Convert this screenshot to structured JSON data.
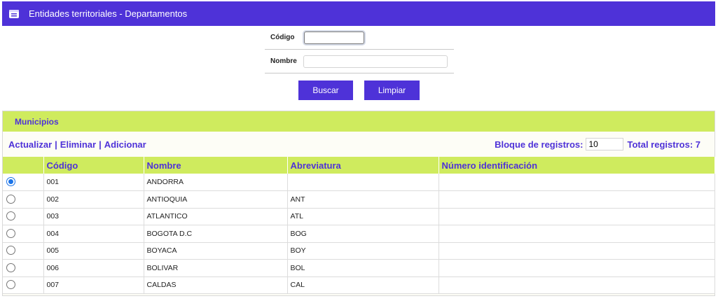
{
  "window": {
    "title": "Entidades territoriales - Departamentos",
    "accent": "#4e32d8",
    "panel_color": "#cfeb5e"
  },
  "search": {
    "codigo_label": "Código",
    "codigo_value": "",
    "nombre_label": "Nombre",
    "nombre_value": "",
    "buscar_label": "Buscar",
    "limpiar_label": "Limpiar"
  },
  "panel": {
    "title": "Municipios",
    "actions": {
      "actualizar": "Actualizar",
      "eliminar": "Eliminar",
      "adicionar": "Adicionar",
      "separator": "|"
    },
    "bloque_label": "Bloque de registros:",
    "bloque_value": "10",
    "total_label": "Total registros: 7"
  },
  "table": {
    "headers": [
      "",
      "Código",
      "Nombre",
      "Abreviatura",
      "Número identificación"
    ],
    "rows": [
      {
        "selected": true,
        "codigo": "001",
        "nombre": "ANDORRA",
        "abreviatura": "",
        "numero": ""
      },
      {
        "selected": false,
        "codigo": "002",
        "nombre": "ANTIOQUIA",
        "abreviatura": "ANT",
        "numero": ""
      },
      {
        "selected": false,
        "codigo": "003",
        "nombre": "ATLANTICO",
        "abreviatura": "ATL",
        "numero": ""
      },
      {
        "selected": false,
        "codigo": "004",
        "nombre": "BOGOTA D.C",
        "abreviatura": "BOG",
        "numero": ""
      },
      {
        "selected": false,
        "codigo": "005",
        "nombre": "BOYACA",
        "abreviatura": "BOY",
        "numero": ""
      },
      {
        "selected": false,
        "codigo": "006",
        "nombre": "BOLIVAR",
        "abreviatura": "BOL",
        "numero": ""
      },
      {
        "selected": false,
        "codigo": "007",
        "nombre": "CALDAS",
        "abreviatura": "CAL",
        "numero": ""
      }
    ]
  }
}
